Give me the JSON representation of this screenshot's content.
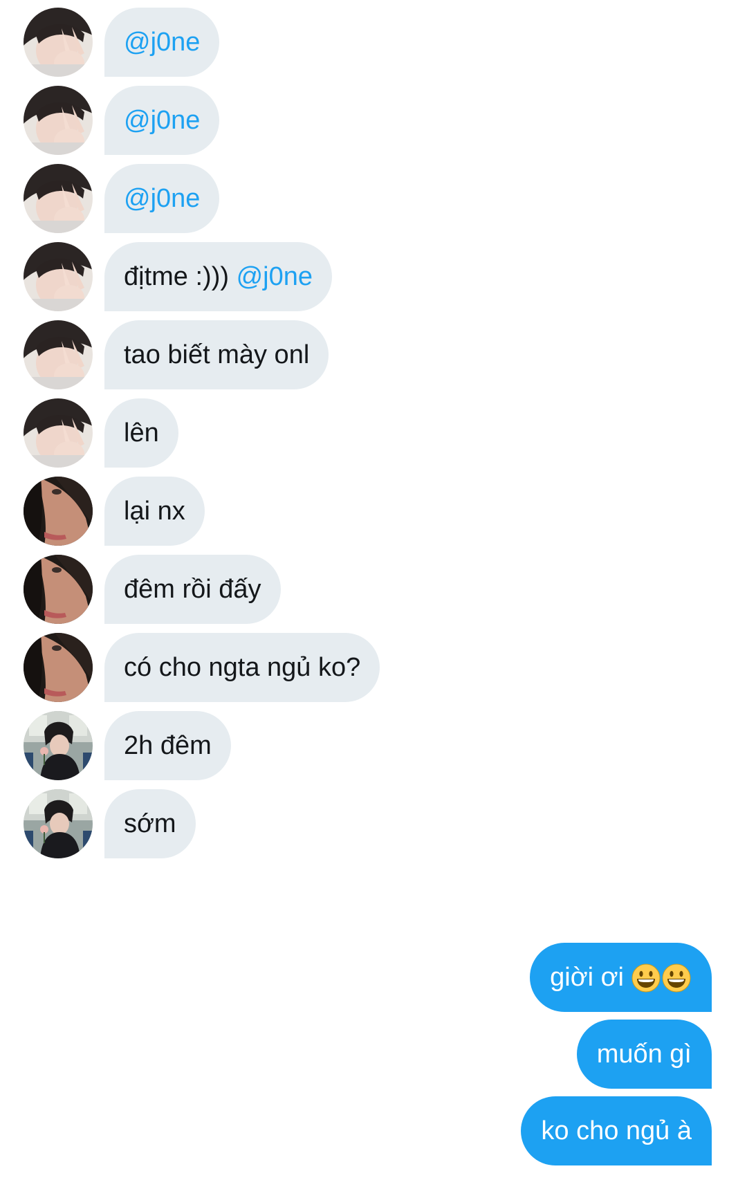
{
  "thread": {
    "incoming": [
      {
        "avatar": "avatar-peace-sign",
        "text": "",
        "mention": "@j0ne"
      },
      {
        "avatar": "avatar-peace-sign",
        "text": "",
        "mention": "@j0ne"
      },
      {
        "avatar": "avatar-peace-sign",
        "text": "",
        "mention": "@j0ne"
      },
      {
        "avatar": "avatar-peace-sign",
        "text": "địtme :))) ",
        "mention": "@j0ne"
      },
      {
        "avatar": "avatar-peace-sign",
        "text": "tao biết mày onl",
        "mention": ""
      },
      {
        "avatar": "avatar-peace-sign",
        "text": "lên",
        "mention": ""
      },
      {
        "avatar": "avatar-dark-hood",
        "text": "lại nx",
        "mention": ""
      },
      {
        "avatar": "avatar-dark-hood",
        "text": "đêm rồi đấy",
        "mention": ""
      },
      {
        "avatar": "avatar-dark-hood",
        "text": "có cho ngta ngủ ko?",
        "mention": ""
      },
      {
        "avatar": "avatar-flower",
        "text": "2h đêm",
        "mention": ""
      },
      {
        "avatar": "avatar-flower",
        "text": "sớm",
        "mention": ""
      }
    ],
    "outgoing": [
      {
        "text": "giời ơi",
        "emoji": [
          "grinning-face-icon",
          "grinning-face-icon"
        ]
      },
      {
        "text": "muốn gì"
      },
      {
        "text": "ko cho ngủ à"
      }
    ]
  },
  "colors": {
    "incoming_bubble": "#e6ecf0",
    "incoming_text": "#14171a",
    "mention": "#1da1f2",
    "outgoing_bubble": "#1da1f2",
    "outgoing_text": "#ffffff"
  }
}
